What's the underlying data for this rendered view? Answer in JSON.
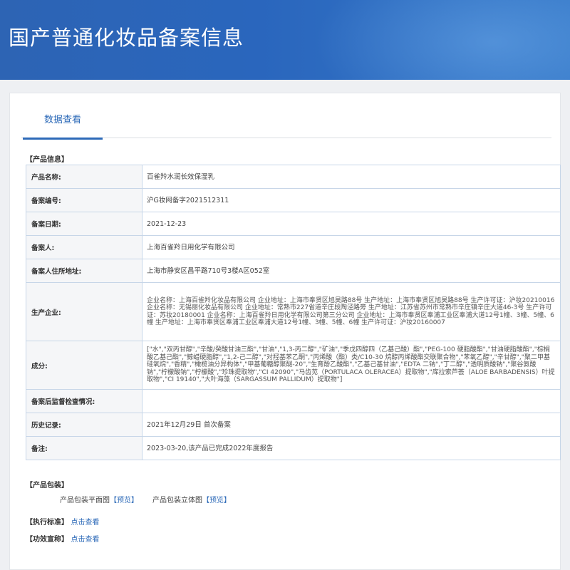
{
  "page": {
    "title": "国产普通化妆品备案信息"
  },
  "tabs": [
    {
      "label": "数据查看"
    }
  ],
  "product_info": {
    "section_title": "【产品信息】",
    "rows": [
      {
        "key": "产品名称:",
        "value": "百雀羚水润长效保湿乳"
      },
      {
        "key": "备案编号:",
        "value": "沪G妆网备字2021512311"
      },
      {
        "key": "备案日期:",
        "value": "2021-12-23"
      },
      {
        "key": "备案人:",
        "value": "上海百雀羚日用化学有限公司"
      },
      {
        "key": "备案人住所地址:",
        "value": "上海市静安区昌平路710号3楼A区052室"
      },
      {
        "key": "生产企业:",
        "value": "企业名称：上海百雀羚化妆品有限公司 企业地址：上海市奉贤区旭昊路88号 生产地址：上海市奉贤区旭昊路88号 生产许可证：沪妆20210016 企业名称：无锡丽化妆品有限公司 企业地址：常熟市227省道辛庄段陶泾路旁 生产地址：江苏省苏州市常熟市辛庄镇辛庄大道46-3号 生产许可证：苏妆20180001 企业名称：上海百雀羚日用化学有限公司第三分公司 企业地址：上海市奉贤区奉浦工业区奉浦大道12号1幢、3幢、5幢、6幢 生产地址：上海市奉贤区奉浦工业区奉浦大道12号1幢、3幢、5幢、6幢 生产许可证：沪妆20160007"
      },
      {
        "key": "成分:",
        "value": "[\"水\",\"双丙甘醇\",\"辛酸/癸酸甘油三酯\",\"甘油\",\"1,3-丙二醇\",\"矿油\",\"季戊四醇四（乙基己酸）酯\",\"PEG-100 硬脂酸酯\",\"甘油硬脂酸酯\",\"棕榈酸乙基己酯\",\"鲸蜡硬脂醇\",\"1,2-己二醇\",\"对羟基苯乙酮\",\"丙烯酸（酯）类/C10-30 烷醇丙烯酸酯交联聚合物\",\"苯氧乙醇\",\"辛甘醇\",\"聚二甲基硅氧烷\",\"香精\",\"橄榄油分异构体\",\"甲基葡糖醇聚醚-20\",\"生育酚乙酸酯\",\"乙基己基甘油\",\"EDTA 二钠\",\"丁二醇\",\"透明质酸钠\",\"聚谷氨酸钠\",\"柠檬酸钠\",\"柠檬酸\",\"珍珠提取物\",\"CI 42090\",\"马齿苋（PORTULACA OLERACEA）提取物\",\"库拉索芦荟（ALOE BARBADENSIS）叶提取物\",\"CI 19140\",\"大叶海藻（SARGASSUM PALLIDUM）提取物\"]"
      },
      {
        "key": "备案后监督检查情况:",
        "value": ""
      },
      {
        "key": "历史记录:",
        "value": "2021年12月29日 首次备案"
      },
      {
        "key": "备注:",
        "value": "2023-03-20,该产品已完成2022年度报告"
      }
    ]
  },
  "packaging": {
    "section_title": "【产品包装】",
    "flat_label": "产品包装平面图",
    "flat_link": "【预览】",
    "stereo_label": "产品包装立体图",
    "stereo_link": "【预览】"
  },
  "standard": {
    "section_title": "【执行标准】",
    "link": "点击查看"
  },
  "efficacy": {
    "section_title": "【功效宣称】",
    "link": "点击查看"
  }
}
